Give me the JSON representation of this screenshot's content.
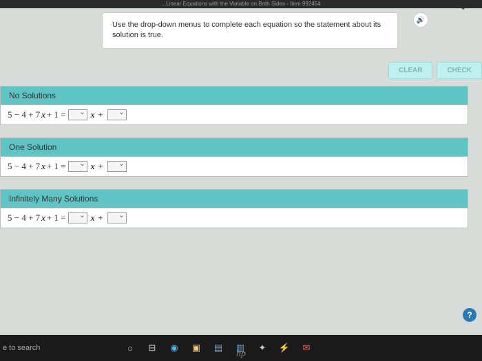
{
  "header": {
    "partial_title": "...Linear Equations with the Variable on Both Sides - Item 992454",
    "quest": "Quest"
  },
  "instruction": "Use the drop-down menus to complete each equation so the statement about its solution is true.",
  "buttons": {
    "clear": "CLEAR",
    "check": "CHECK"
  },
  "problems": [
    {
      "title": "No Solutions",
      "lhs": "5 − 4 + 7",
      "var": "x",
      "after_var": " + 1 =",
      "mid": "x",
      "plus": "+"
    },
    {
      "title": "One Solution",
      "lhs": "5 − 4 + 7",
      "var": "x",
      "after_var": " + 1 =",
      "mid": "x",
      "plus": "+"
    },
    {
      "title": "Infinitely Many Solutions",
      "lhs": "5 − 4 + 7",
      "var": "x",
      "after_var": " + 1 =",
      "mid": "x",
      "plus": "+"
    }
  ],
  "taskbar": {
    "search": "e to search",
    "logo": "hp"
  },
  "help": "?"
}
